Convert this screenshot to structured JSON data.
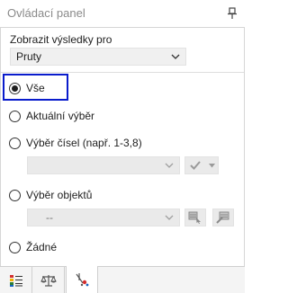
{
  "window": {
    "title": "Ovládací panel"
  },
  "display": {
    "label": "Zobrazit výsledky pro",
    "selected": "Pruty"
  },
  "options": {
    "all": "Vše",
    "current_selection": "Aktuální výběr",
    "number_selection": "Výběr čísel (např. 1-3,8)",
    "object_selection": "Výběr objektů",
    "none": "Žádné"
  },
  "object_combo": {
    "value": "--"
  },
  "selected_option": "all",
  "colors": {
    "highlight": "#0a1ccc"
  },
  "tabs": [
    {
      "icon": "color-scale-icon"
    },
    {
      "icon": "balance-scale-icon"
    },
    {
      "icon": "filter-members-icon"
    }
  ]
}
